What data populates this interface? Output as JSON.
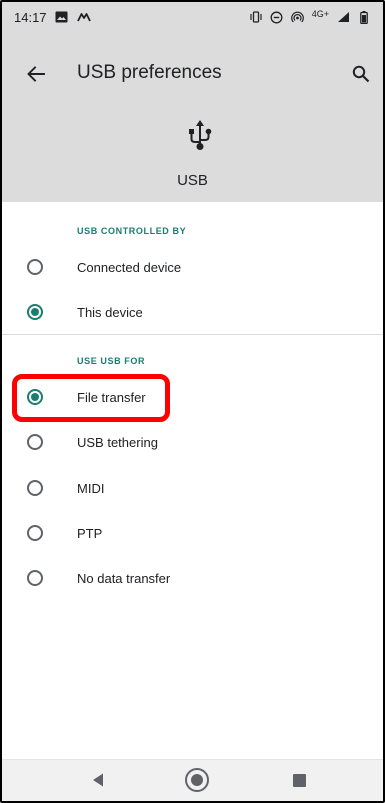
{
  "status_bar": {
    "time": "14:17",
    "left_icons": [
      "image-icon",
      "m-logo-icon"
    ],
    "right_icons": [
      "vibrate-icon",
      "dnd-icon",
      "hotspot-icon",
      "signal-icon",
      "battery-icon"
    ],
    "network_label": "4G+"
  },
  "app_bar": {
    "title": "USB preferences",
    "back_icon": "arrow-left-icon",
    "search_icon": "search-icon"
  },
  "hero": {
    "icon": "usb-icon",
    "label": "USB"
  },
  "usb_controlled_by": {
    "header": "USB CONTROLLED BY",
    "options": [
      {
        "label": "Connected device",
        "selected": false
      },
      {
        "label": "This device",
        "selected": true
      }
    ]
  },
  "use_usb_for": {
    "header": "USE USB FOR",
    "options": [
      {
        "label": "File transfer",
        "selected": true
      },
      {
        "label": "USB tethering",
        "selected": false
      },
      {
        "label": "MIDI",
        "selected": false
      },
      {
        "label": "PTP",
        "selected": false
      },
      {
        "label": "No data transfer",
        "selected": false
      }
    ]
  },
  "colors": {
    "accent": "#1a7d6f",
    "highlight": "#ff0000",
    "header_bg": "#dcdcdc"
  },
  "nav_bar": {
    "icons": [
      "nav-back-icon",
      "nav-home-icon",
      "nav-recents-icon"
    ]
  }
}
